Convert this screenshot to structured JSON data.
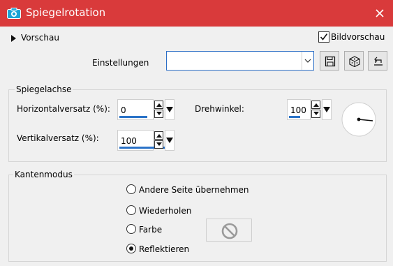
{
  "window": {
    "title": "Spiegelrotation"
  },
  "preview": {
    "label": "Vorschau",
    "live_preview_label": "Bildvorschau",
    "live_preview_checked": true
  },
  "settings": {
    "label": "Einstellungen",
    "value": ""
  },
  "mirror_axis": {
    "group_label": "Spiegelachse",
    "horizontal_offset": {
      "label": "Horizontalversatz (%):",
      "value": "0"
    },
    "vertical_offset": {
      "label": "Vertikalversatz (%):",
      "value": "100"
    },
    "rotation_angle": {
      "label": "Drehwinkel:",
      "value": "100"
    }
  },
  "edge_mode": {
    "group_label": "Kantenmodus",
    "options": [
      {
        "label": "Andere Seite übernehmen",
        "selected": false
      },
      {
        "label": "Wiederholen",
        "selected": false
      },
      {
        "label": "Farbe",
        "selected": false
      },
      {
        "label": "Reflektieren",
        "selected": true
      }
    ]
  },
  "icons": [
    "camera-icon",
    "close-icon",
    "save-icon",
    "random-dice-icon",
    "reset-icon",
    "no-color-icon"
  ],
  "colors": {
    "titlebar": "#d93a3b",
    "accent": "#2b73c8",
    "background": "#f0f0f0"
  }
}
